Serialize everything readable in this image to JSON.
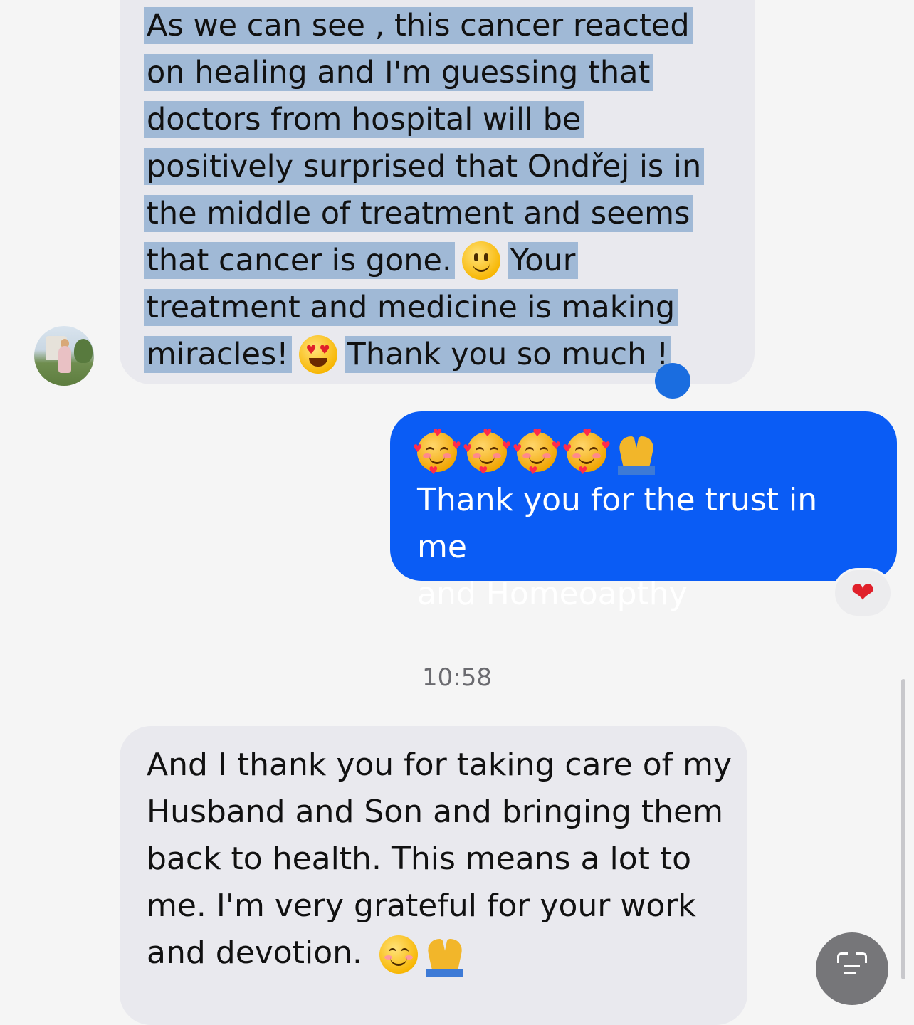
{
  "messages": {
    "incoming_1": {
      "lines": [
        "As we can see , this cancer reacted",
        "on healing and I'm guessing that",
        "doctors from hospital will be",
        "positively surprised that Ondřej is in",
        "the middle of treatment and seems"
      ],
      "line6_a": "that cancer is gone.",
      "line6_b": "Your",
      "line7": "treatment and medicine is making",
      "line8_a": "miracles!",
      "line8_b": "Thank you so much !"
    },
    "outgoing_1": {
      "emojis": [
        "smiling-face-with-hearts",
        "smiling-face-with-hearts",
        "smiling-face-with-hearts",
        "smiling-face-with-hearts",
        "folded-hands"
      ],
      "line1": "Thank you for the trust in me",
      "line2": "and Homeoapthy",
      "reaction": "❤"
    },
    "timestamp": "10:58",
    "incoming_2": {
      "line1": "And I thank you for taking care of my",
      "line2": "Husband and Son and bringing them",
      "line3": "back to health. This means a lot to",
      "line4": "me. I'm very grateful for your work",
      "line5": "and devotion."
    }
  },
  "colors": {
    "outgoing_bubble": "#0a5cf5",
    "incoming_bubble": "#e9e9ee",
    "selection": "#a0b9d6",
    "selection_handle": "#1a6de0",
    "background": "#f5f5f5"
  },
  "icons": {
    "scan_button": "live-text-scan-icon"
  }
}
